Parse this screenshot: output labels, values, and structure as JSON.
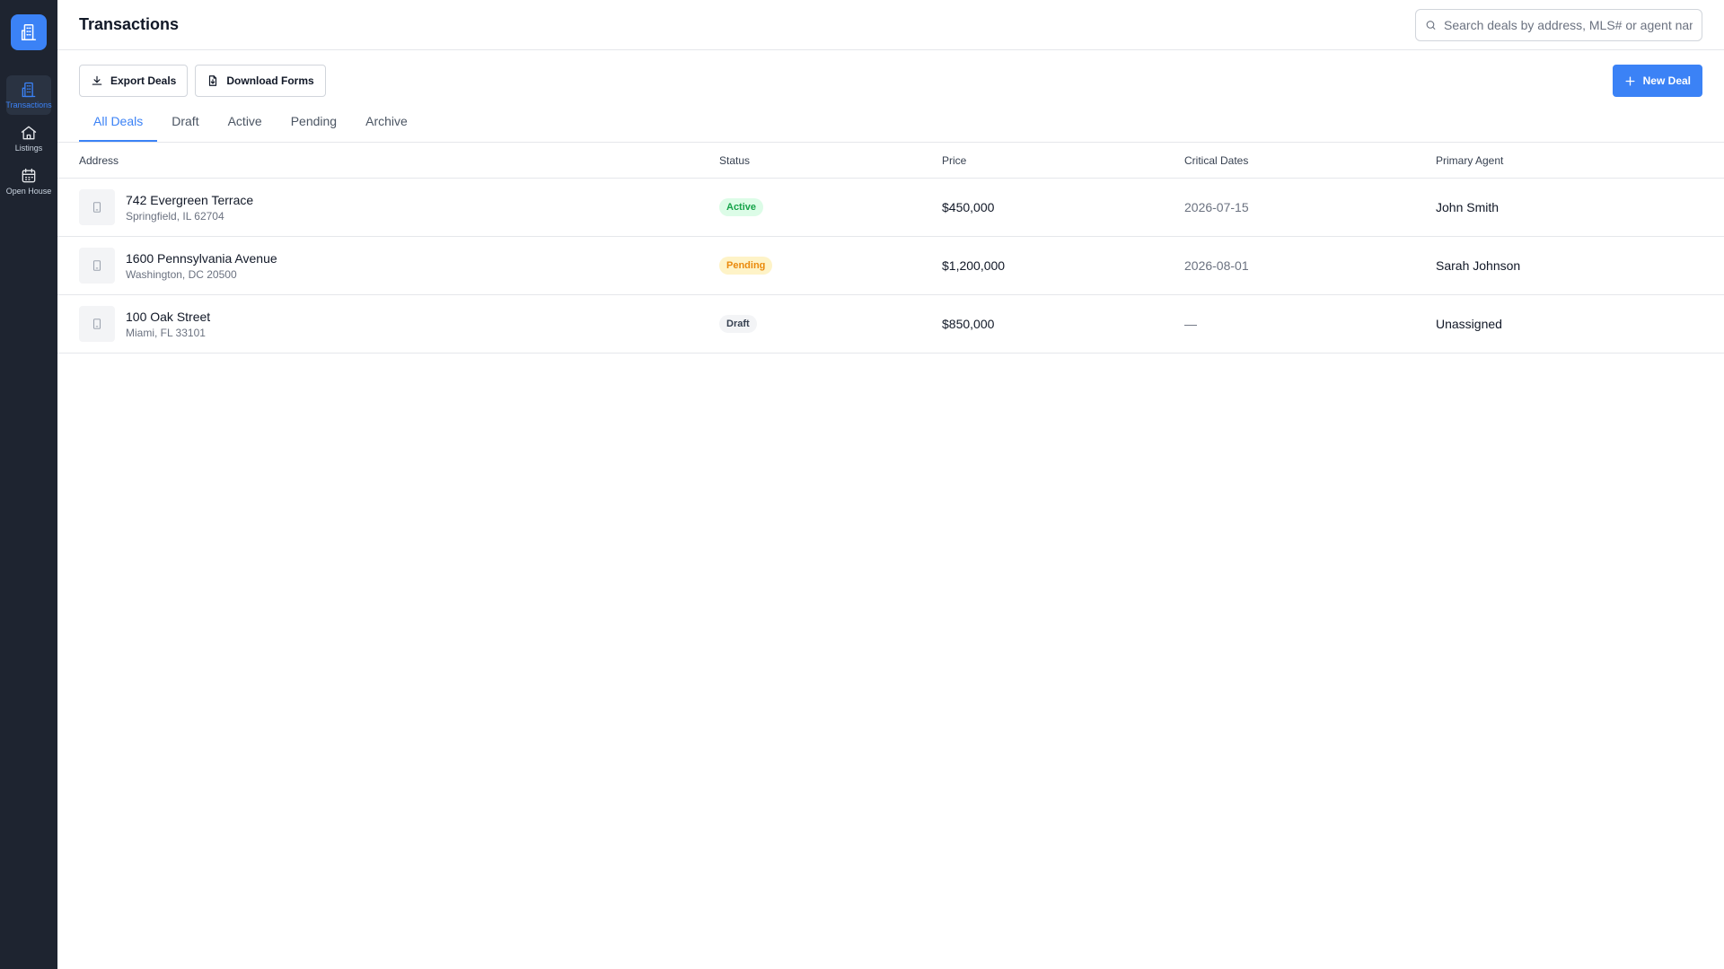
{
  "sidebar": {
    "logo": {
      "icon": "building-icon",
      "color": "#3b82f6"
    },
    "items": [
      {
        "label": "Transactions",
        "icon": "building-icon",
        "active": true
      },
      {
        "label": "Listings",
        "icon": "home-icon",
        "active": false
      },
      {
        "label": "Open House",
        "icon": "calendar-icon",
        "active": false
      }
    ]
  },
  "header": {
    "title": "Transactions",
    "search_placeholder": "Search deals by address, MLS# or agent name"
  },
  "toolbar": {
    "export_label": "Export Deals",
    "download_label": "Download Forms",
    "new_deal_label": "New Deal"
  },
  "tabs": [
    {
      "label": "All Deals",
      "active": true
    },
    {
      "label": "Draft",
      "active": false
    },
    {
      "label": "Active",
      "active": false
    },
    {
      "label": "Pending",
      "active": false
    },
    {
      "label": "Archive",
      "active": false
    }
  ],
  "table": {
    "columns": [
      "Address",
      "Status",
      "Price",
      "Critical Dates",
      "Primary Agent"
    ],
    "rows": [
      {
        "address": "742 Evergreen Terrace",
        "city": "Springfield, IL 62704",
        "status": "Active",
        "price": "$450,000",
        "critical_date": "2026-07-15",
        "agent": "John Smith"
      },
      {
        "address": "1600 Pennsylvania Avenue",
        "city": "Washington, DC 20500",
        "status": "Pending",
        "price": "$1,200,000",
        "critical_date": "2026-08-01",
        "agent": "Sarah Johnson"
      },
      {
        "address": "100 Oak Street",
        "city": "Miami, FL 33101",
        "status": "Draft",
        "price": "$850,000",
        "critical_date": "—",
        "agent": "Unassigned"
      }
    ]
  },
  "colors": {
    "accent": "#3b82f6",
    "sidebar_bg": "#1e2430",
    "status_active": "#16a34a",
    "status_active_bg": "#dcfce7",
    "status_pending": "#ea8a0c",
    "status_pending_bg": "#fef3c7",
    "status_draft": "#374151",
    "status_draft_bg": "#f3f4f6"
  }
}
